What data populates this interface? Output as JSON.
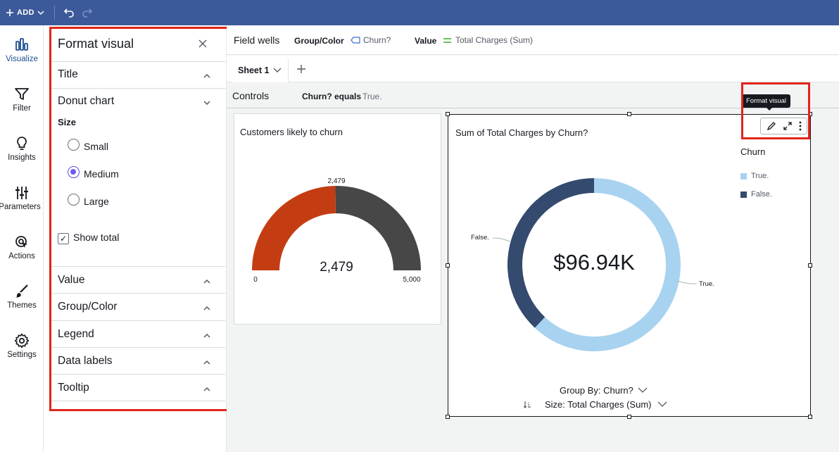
{
  "topbar": {
    "add_label": "ADD"
  },
  "nav": {
    "items": [
      {
        "label": "Visualize",
        "icon": "bar-chart-icon",
        "active": true
      },
      {
        "label": "Filter",
        "icon": "filter-icon"
      },
      {
        "label": "Insights",
        "icon": "lightbulb-icon"
      },
      {
        "label": "Parameters",
        "icon": "sliders-icon"
      },
      {
        "label": "Actions",
        "icon": "cursor-click-icon"
      },
      {
        "label": "Themes",
        "icon": "brush-icon"
      },
      {
        "label": "Settings",
        "icon": "gear-icon"
      }
    ]
  },
  "format_panel": {
    "title": "Format visual",
    "sections": {
      "title": "Title",
      "donut": "Donut chart",
      "value": "Value",
      "group_color": "Group/Color",
      "legend": "Legend",
      "data_labels": "Data labels",
      "tooltip": "Tooltip"
    },
    "size_label": "Size",
    "size_options": [
      "Small",
      "Medium",
      "Large"
    ],
    "size_selected": "Medium",
    "show_total_label": "Show total",
    "show_total_checked": true
  },
  "field_wells": {
    "title": "Field wells",
    "group_label": "Group/Color",
    "group_value": "Churn?",
    "value_label": "Value",
    "value_value": "Total Charges (Sum)"
  },
  "sheets": {
    "tabs": [
      "Sheet 1"
    ]
  },
  "controls": {
    "title": "Controls",
    "filter_label": "Churn? equals",
    "filter_value": "True."
  },
  "gauge": {
    "title": "Customers likely to churn",
    "value_text": "2,479",
    "marker_text": "2,479",
    "min_text": "0",
    "max_text": "5,000",
    "value": 2479,
    "min": 0,
    "max": 5000,
    "colors": {
      "filled": "#c43d12",
      "remaining": "#474747"
    }
  },
  "donut": {
    "title": "Sum of Total Charges by Churn?",
    "center_text": "$96.94K",
    "legend_title": "Churn",
    "tooltip_text": "Format visual",
    "group_by_label": "Group By: Churn?",
    "size_label": "Size: Total Charges (Sum)"
  },
  "chart_data": {
    "type": "pie",
    "categories": [
      "True.",
      "False."
    ],
    "values": [
      0.62,
      0.38
    ],
    "total_label": "$96.94K",
    "colors": [
      "#a8d3f0",
      "#344a6e"
    ]
  }
}
